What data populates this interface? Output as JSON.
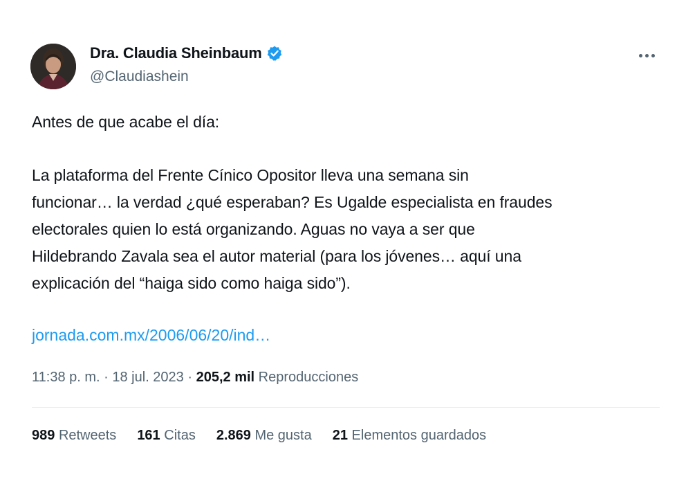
{
  "author": {
    "display_name": "Dra. Claudia Sheinbaum",
    "handle": "@Claudiashein",
    "verified_icon": "verified-badge-icon",
    "verified_color": "#1d9bf0"
  },
  "tweet": {
    "lines": [
      "Antes de que acabe el día:",
      "La plataforma del Frente Cínico Opositor lleva una semana sin",
      "funcionar… la verdad ¿qué esperaban? Es Ugalde especialista en fraudes",
      "electorales quien lo está organizando. Aguas no vaya a ser que",
      "Hildebrando Zavala sea el autor material (para los jóvenes… aquí una",
      "explicación del “haiga sido como haiga sido”)."
    ],
    "link": "jornada.com.mx/2006/06/20/ind…"
  },
  "meta": {
    "time": "11:38 p. m.",
    "separator": "·",
    "date": "18 jul. 2023",
    "views_count": "205,2 mil",
    "views_label": "Reproducciones"
  },
  "stats": {
    "retweets_count": "989",
    "retweets_label": "Retweets",
    "quotes_count": "161",
    "quotes_label": "Citas",
    "likes_count": "2.869",
    "likes_label": "Me gusta",
    "bookmarks_count": "21",
    "bookmarks_label": "Elementos guardados"
  },
  "colors": {
    "text": "#0f1419",
    "secondary": "#536471",
    "link": "#1d9bf0",
    "divider": "#e6ecf0"
  }
}
